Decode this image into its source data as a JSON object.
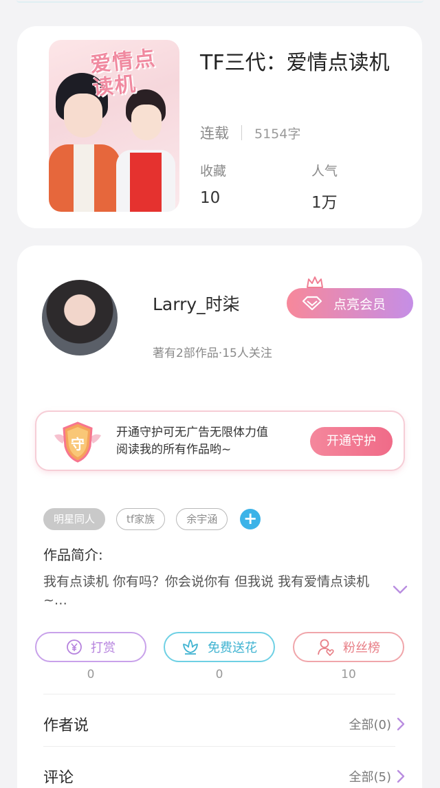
{
  "book": {
    "cover_title": "爱情点读机",
    "title": "TF三代：爱情点读机",
    "status": "连载",
    "word_count": "5154字",
    "favorites_label": "收藏",
    "favorites_value": "10",
    "popularity_label": "人气",
    "popularity_value": "1万"
  },
  "author": {
    "name": "Larry_时柒",
    "subtitle": "著有2部作品·15人关注",
    "vip_label": "点亮会员"
  },
  "guard": {
    "shield_char": "守",
    "text_line1": "开通守护可无广告无限体力值",
    "text_line2": "阅读我的所有作品哟~",
    "button_label": "开通守护"
  },
  "tags": [
    "明星同人",
    "tf家族",
    "余宇涵"
  ],
  "intro": {
    "heading": "作品简介:",
    "text": "我有点读机 你有吗？你会说你有 但我说 我有爱情点读机~…"
  },
  "actions": [
    {
      "label": "打赏",
      "count": "0",
      "icon": "yen-icon",
      "color": "#b683de"
    },
    {
      "label": "免费送花",
      "count": "0",
      "icon": "flower-icon",
      "color": "#3fb3d1"
    },
    {
      "label": "粉丝榜",
      "count": "10",
      "icon": "fans-icon",
      "color": "#e87e86"
    }
  ],
  "sections": [
    {
      "title": "作者说",
      "link": "全部(0)"
    },
    {
      "title": "评论",
      "link": "全部(5)"
    }
  ]
}
